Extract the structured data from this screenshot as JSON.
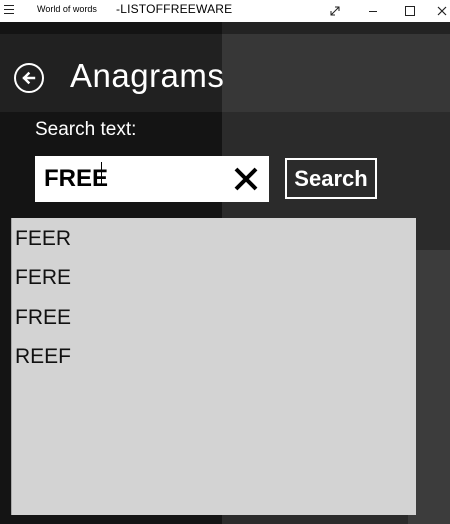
{
  "window": {
    "app_title": "World of words",
    "watermark": "-LISTOFFREEWARE"
  },
  "header": {
    "title": "Anagrams"
  },
  "search": {
    "label": "Search text:",
    "value": "FREE",
    "button_label": "Search"
  },
  "results": {
    "items": [
      "FEER",
      "FERE",
      "FREE",
      "REEF"
    ]
  },
  "icons": {
    "back": "back-arrow-icon",
    "clear": "close-icon",
    "menu": "hamburger-icon"
  },
  "colors": {
    "background": "#1a1a1a",
    "results_bg": "#d3d3d3",
    "text_light": "#ffffff"
  }
}
